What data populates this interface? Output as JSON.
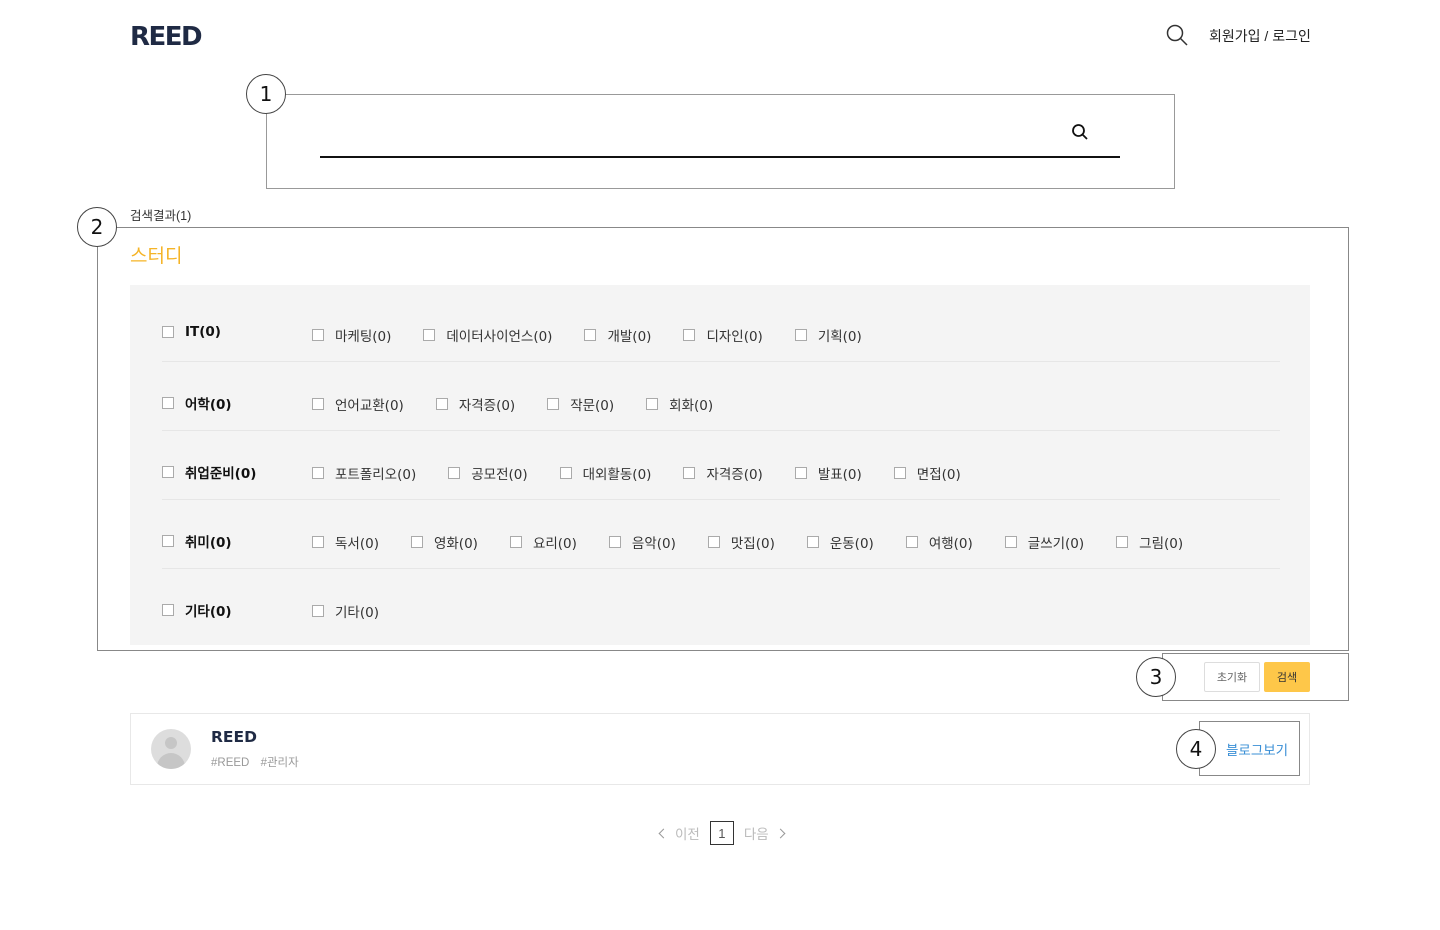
{
  "header": {
    "logo": "REED",
    "auth_link": "회원가입 / 로그인"
  },
  "search": {
    "placeholder": ""
  },
  "markers": [
    "1",
    "2",
    "3",
    "4"
  ],
  "results": {
    "count_label": "검색결과(1)",
    "category_title": "스터디"
  },
  "filters": [
    {
      "main": "IT(0)",
      "subs": [
        "마케팅(0)",
        "데이터사이언스(0)",
        "개발(0)",
        "디자인(0)",
        "기획(0)"
      ]
    },
    {
      "main": "어학(0)",
      "subs": [
        "언어교환(0)",
        "자격증(0)",
        "작문(0)",
        "회화(0)"
      ]
    },
    {
      "main": "취업준비(0)",
      "subs": [
        "포트폴리오(0)",
        "공모전(0)",
        "대외활동(0)",
        "자격증(0)",
        "발표(0)",
        "면접(0)"
      ]
    },
    {
      "main": "취미(0)",
      "subs": [
        "독서(0)",
        "영화(0)",
        "요리(0)",
        "음악(0)",
        "맛집(0)",
        "운동(0)",
        "여행(0)",
        "글쓰기(0)",
        "그림(0)"
      ]
    },
    {
      "main": "기타(0)",
      "subs": [
        "기타(0)"
      ]
    }
  ],
  "actions": {
    "reset_label": "초기화",
    "search_label": "검색"
  },
  "result_card": {
    "name": "REED",
    "tags": [
      "#REED",
      "#관리자"
    ],
    "blog_link": "블로그보기"
  },
  "pagination": {
    "prev": "이전",
    "current": "1",
    "next": "다음"
  },
  "colors": {
    "accent": "#f5b427",
    "button": "#fec749",
    "link": "#3a8fd6",
    "brand": "#1f2a44"
  }
}
